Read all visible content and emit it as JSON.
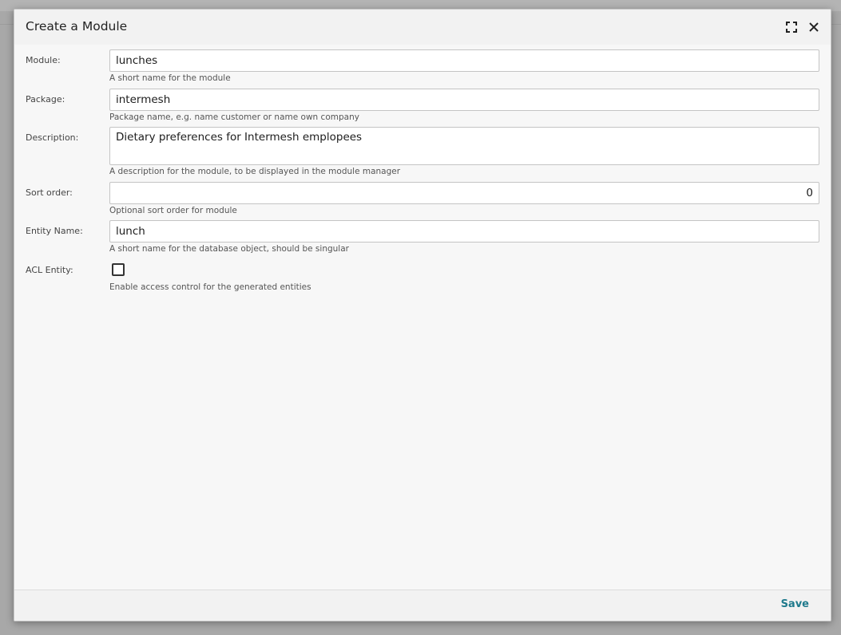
{
  "dialog": {
    "title": "Create a Module"
  },
  "header_icons": {
    "maximize": "maximize-icon",
    "close": "close-icon"
  },
  "form": {
    "module": {
      "label": "Module:",
      "value": "lunches",
      "hint": "A short name for the module"
    },
    "package": {
      "label": "Package:",
      "value": "intermesh",
      "hint": "Package name, e.g. name customer or name own company"
    },
    "description": {
      "label": "Description:",
      "value": "Dietary preferences for Intermesh emplopees",
      "hint": "A description for the module, to be displayed in the module manager"
    },
    "sort_order": {
      "label": "Sort order:",
      "value": "0",
      "hint": "Optional sort order for module"
    },
    "entity_name": {
      "label": "Entity Name:",
      "value": "lunch",
      "hint": "A short name for the database object, should be singular"
    },
    "acl_entity": {
      "label": "ACL Entity:",
      "checked": false,
      "hint": "Enable access control for the generated entities"
    }
  },
  "footer": {
    "save_label": "Save"
  },
  "colors": {
    "accent": "#1f7a8c"
  }
}
